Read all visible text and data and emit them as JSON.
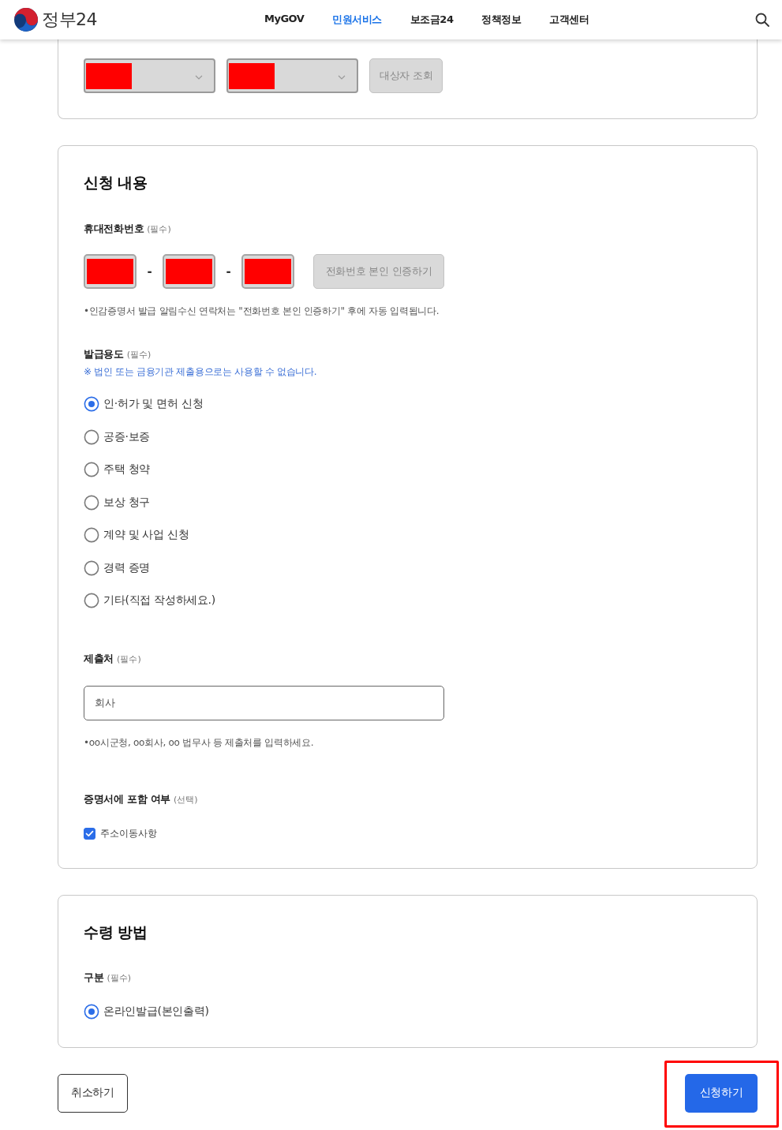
{
  "header": {
    "logo_text": "정부24",
    "nav": [
      {
        "label": "MyGOV",
        "selected": false
      },
      {
        "label": "민원서비스",
        "selected": true
      },
      {
        "label": "보조금24",
        "selected": false
      },
      {
        "label": "정책정보",
        "selected": false
      },
      {
        "label": "고객센터",
        "selected": false
      }
    ]
  },
  "target_card": {
    "selects": [
      {
        "disabled": true,
        "redacted": true
      },
      {
        "disabled": true,
        "redacted": true
      }
    ],
    "button": {
      "label": "대상자 조회",
      "disabled": true
    }
  },
  "application": {
    "title": "신청 내용",
    "phone": {
      "label": "휴대전화번호",
      "tag": "(필수)",
      "fields": [
        {
          "disabled": true,
          "redacted": true
        },
        {
          "disabled": true,
          "redacted": true
        },
        {
          "disabled": true,
          "redacted": true
        }
      ],
      "separators": [
        "-",
        "-"
      ],
      "button": {
        "label": "전화번호 본인 인증하기",
        "disabled": true
      },
      "note": "•인감증명서 발급 알림수신 연락처는 \"전화번호 본인 인증하기\" 후에 자동 입력됩니다."
    },
    "purpose": {
      "label": "발급용도",
      "tag": "(필수)",
      "notice": "※ 법인 또는 금융기관 제출용으로는 사용할 수 없습니다.",
      "options": [
        {
          "label": "인·허가 및 면허 신청",
          "selected": true
        },
        {
          "label": "공증·보증",
          "selected": false
        },
        {
          "label": "주택 청약",
          "selected": false
        },
        {
          "label": "보상 청구",
          "selected": false
        },
        {
          "label": "계약 및 사업 신청",
          "selected": false
        },
        {
          "label": "경력 증명",
          "selected": false
        },
        {
          "label": "기타(직접 작성하세요.)",
          "selected": false
        }
      ]
    },
    "submit_to": {
      "label": "제출처",
      "tag": "(필수)",
      "value": "회사",
      "note": "•oo시군청, oo회사, oo 법무사 등 제출처를 입력하세요."
    },
    "include": {
      "label": "증명서에 포함 여부",
      "tag": "(선택)",
      "options": [
        {
          "label": "주소이동사항",
          "checked": true
        }
      ]
    }
  },
  "receipt": {
    "title": "수령 방법",
    "method": {
      "label": "구분",
      "tag": "(필수)",
      "options": [
        {
          "label": "온라인발급(본인출력)",
          "selected": true
        }
      ]
    }
  },
  "actions": [
    {
      "kind": "secondary",
      "label": "취소하기",
      "highlighted": false
    },
    {
      "kind": "primary",
      "label": "신청하기",
      "highlighted": true
    }
  ]
}
